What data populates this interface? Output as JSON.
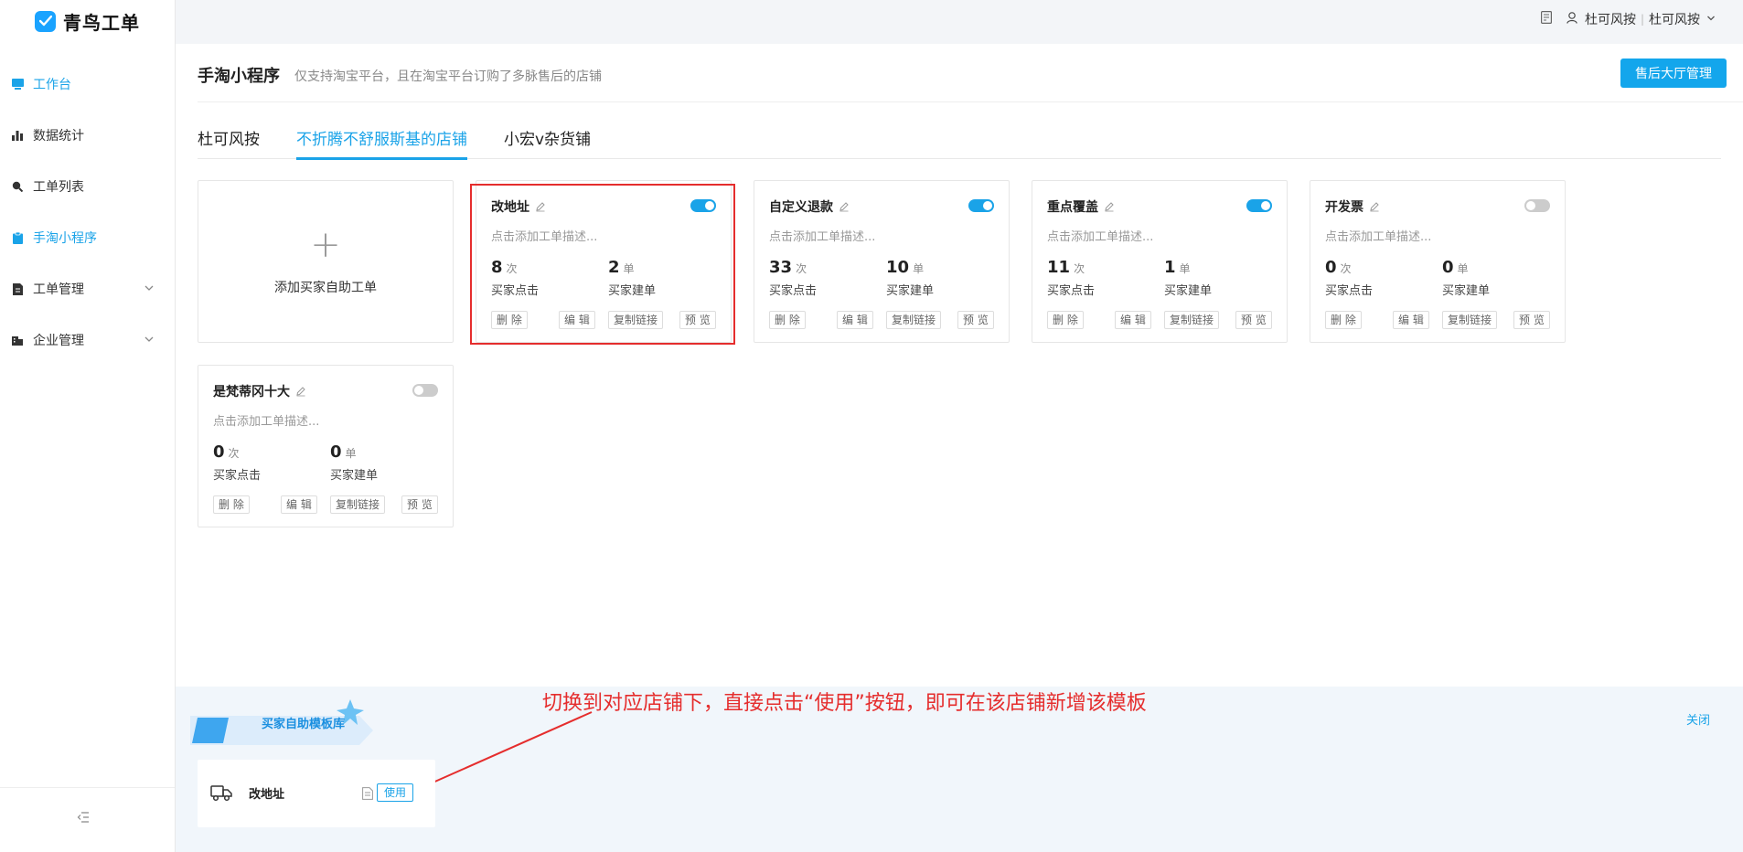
{
  "app": {
    "name": "青鸟工单"
  },
  "sidebar": {
    "items": [
      {
        "label": "工作台",
        "icon": "monitor-icon"
      },
      {
        "label": "数据统计",
        "icon": "bar-chart-icon"
      },
      {
        "label": "工单列表",
        "icon": "search-icon"
      },
      {
        "label": "手淘小程序",
        "icon": "clipboard-icon",
        "active": true
      },
      {
        "label": "工单管理",
        "icon": "document-icon",
        "expandable": true
      },
      {
        "label": "企业管理",
        "icon": "building-icon",
        "expandable": true
      }
    ],
    "collapse_icon": "collapse-icon"
  },
  "topbar": {
    "user_label": "杜可风按",
    "separator": "|",
    "account_label": "杜可风按"
  },
  "header": {
    "title": "手淘小程序",
    "description": "仅支持淘宝平台，且在淘宝平台订购了多脉售后的店铺",
    "primary_button": "售后大厅管理"
  },
  "tabs": [
    {
      "label": "杜可风按",
      "active": false
    },
    {
      "label": "不折腾不舒服斯基的店铺",
      "active": true
    },
    {
      "label": "小宏v杂货铺",
      "active": false
    }
  ],
  "add_card": {
    "label": "添加买家自助工单"
  },
  "cards": [
    {
      "title": "改地址",
      "enabled": true,
      "desc": "点击添加工单描述...",
      "clicks": "8",
      "click_unit": "次",
      "click_label": "买家点击",
      "orders": "2",
      "order_unit": "单",
      "order_label": "买家建单"
    },
    {
      "title": "自定义退款",
      "enabled": true,
      "desc": "点击添加工单描述...",
      "clicks": "33",
      "click_unit": "次",
      "click_label": "买家点击",
      "orders": "10",
      "order_unit": "单",
      "order_label": "买家建单"
    },
    {
      "title": "重点覆盖",
      "enabled": true,
      "desc": "点击添加工单描述...",
      "clicks": "11",
      "click_unit": "次",
      "click_label": "买家点击",
      "orders": "1",
      "order_unit": "单",
      "order_label": "买家建单"
    },
    {
      "title": "开发票",
      "enabled": false,
      "desc": "点击添加工单描述...",
      "clicks": "0",
      "click_unit": "次",
      "click_label": "买家点击",
      "orders": "0",
      "order_unit": "单",
      "order_label": "买家建单"
    },
    {
      "title": "是梵蒂冈十大",
      "enabled": false,
      "desc": "点击添加工单描述...",
      "clicks": "0",
      "click_unit": "次",
      "click_label": "买家点击",
      "orders": "0",
      "order_unit": "单",
      "order_label": "买家建单"
    }
  ],
  "card_actions": {
    "delete": "删 除",
    "edit": "编 辑",
    "copy_link": "复制链接",
    "preview": "预 览"
  },
  "template_library": {
    "label": "买家自助模板库",
    "close": "关闭",
    "annotation": "切换到对应店铺下，直接点击“使用”按钮，即可在该店铺新增该模板",
    "templates": [
      {
        "name": "改地址",
        "use_label": "使用"
      }
    ]
  },
  "colors": {
    "accent": "#1aa3e8",
    "primary_button": "#13a6ec",
    "annotation": "#e52d2d"
  }
}
